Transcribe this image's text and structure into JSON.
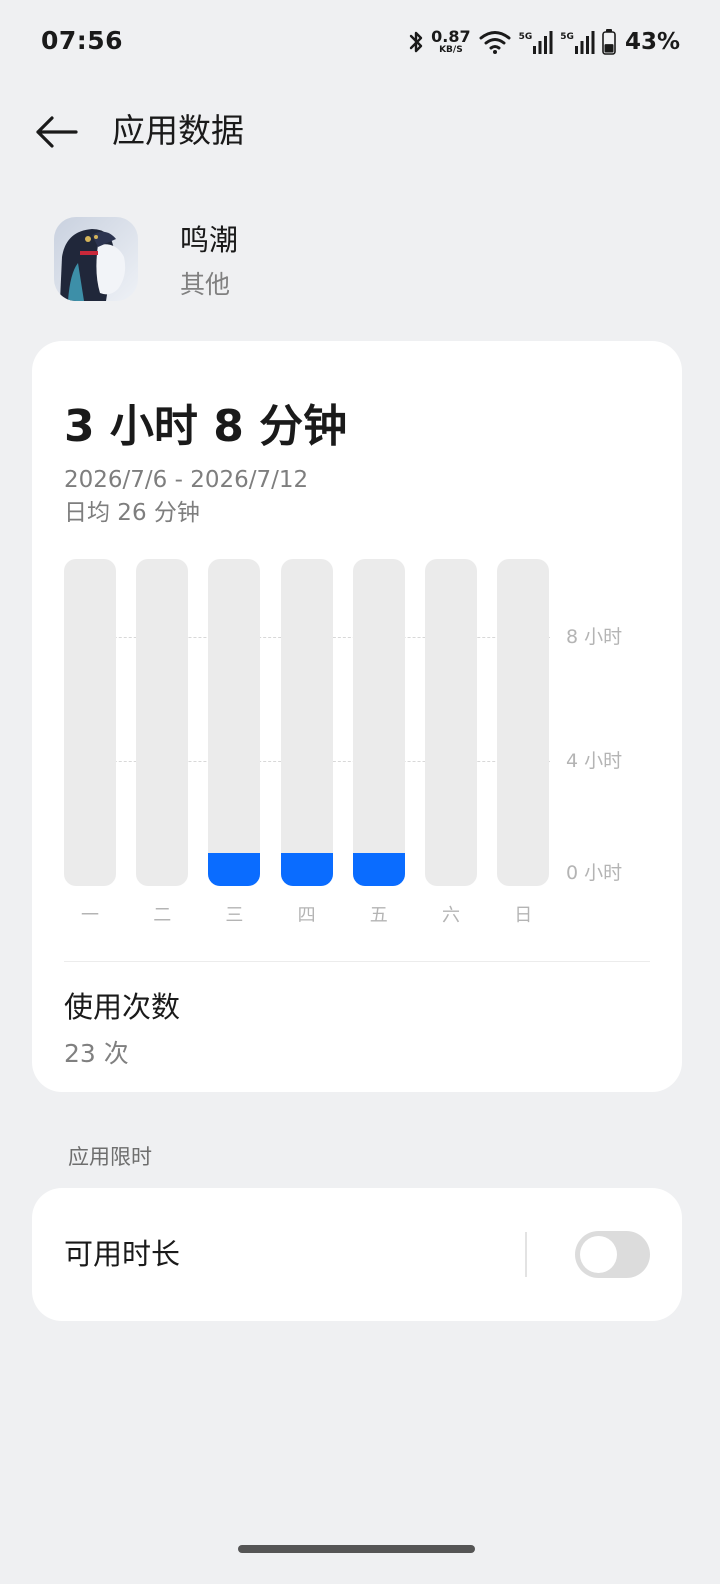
{
  "status_bar": {
    "time": "07:56",
    "net_speed_value": "0.87",
    "net_speed_unit": "KB/S",
    "sim1_tag": "5G",
    "sim2_tag": "5G",
    "battery_percent": "43%",
    "battery_level": 0.43
  },
  "header": {
    "title": "应用数据",
    "back_icon": "arrow-left-icon"
  },
  "app": {
    "name": "鸣潮",
    "category": "其他",
    "icon": "app-icon-game-character"
  },
  "usage": {
    "total_time": "3 小时 8 分钟",
    "date_range": "2026/7/6 - 2026/7/12",
    "daily_average": "日均 26 分钟",
    "launch_title": "使用次数",
    "launch_count": "23 次"
  },
  "chart_data": {
    "type": "bar",
    "categories": [
      "一",
      "二",
      "三",
      "四",
      "五",
      "六",
      "日"
    ],
    "values": [
      0,
      0,
      1.05,
      1.05,
      1.05,
      0,
      0
    ],
    "unit": "hours",
    "y_ticks": [
      {
        "value": 0,
        "label": "0 小时"
      },
      {
        "value": 4,
        "label": "4 小时"
      },
      {
        "value": 8,
        "label": "8 小时"
      }
    ],
    "ylim": [
      0,
      10.5
    ],
    "grid": true,
    "bar_color": "#0a6cff",
    "track_color": "#ebebeb"
  },
  "limits": {
    "section_title": "应用限时",
    "available_duration_label": "可用时长",
    "toggle_on": false
  }
}
